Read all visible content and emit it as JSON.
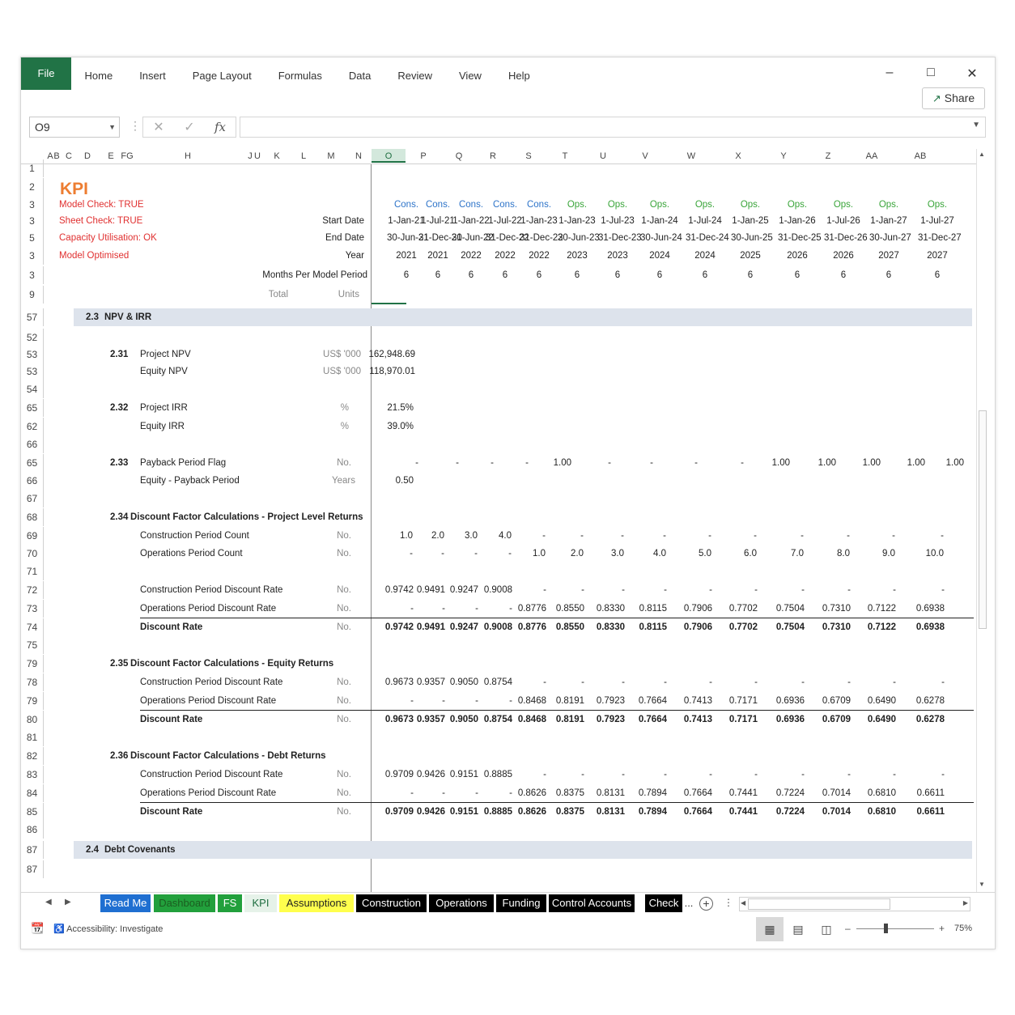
{
  "ribbon": {
    "file": "File",
    "menu": [
      "Home",
      "Insert",
      "Page Layout",
      "Formulas",
      "Data",
      "Review",
      "View",
      "Help"
    ],
    "share": "Share",
    "minimize": "–",
    "maximize": "□",
    "close": "✕"
  },
  "formula_bar": {
    "name_box": "O9",
    "fx": "fx",
    "cancel": "✕",
    "enter": "✓",
    "content": ""
  },
  "columns": [
    "A",
    "B",
    "C",
    "D",
    "E",
    "FG",
    "H",
    "J",
    "U",
    "K",
    "L",
    "M",
    "N",
    "O",
    "P",
    "Q",
    "R",
    "S",
    "T",
    "U",
    "V",
    "W",
    "X",
    "Y",
    "Z",
    "AA",
    "AB"
  ],
  "header": {
    "title": "KPI",
    "checks": [
      "Model Check: TRUE",
      "Sheet Check: TRUE",
      "Capacity Utilisation: OK",
      "Model Optimised"
    ],
    "row_labels": {
      "start": "Start Date",
      "end": "End Date",
      "year": "Year",
      "months": "Months Per Model Period",
      "total": "Total",
      "units": "Units"
    },
    "phases": [
      "Cons.",
      "Cons.",
      "Cons.",
      "Cons.",
      "Cons.",
      "Ops.",
      "Ops.",
      "Ops.",
      "Ops.",
      "Ops.",
      "Ops.",
      "Ops.",
      "Ops.",
      "Ops."
    ],
    "start_dates": [
      "1-Jan-21",
      "1-Jul-21",
      "1-Jan-22",
      "1-Jul-22",
      "1-Jan-23",
      "1-Jan-23",
      "1-Jul-23",
      "1-Jan-24",
      "1-Jul-24",
      "1-Jan-25",
      "1-Jan-26",
      "1-Jul-26",
      "1-Jan-27",
      "1-Jul-27"
    ],
    "end_dates": [
      "30-Jun-21",
      "31-Dec-21",
      "30-Jun-22",
      "31-Dec-22",
      "31-Dec-22",
      "30-Jun-23",
      "31-Dec-23",
      "30-Jun-24",
      "31-Dec-24",
      "30-Jun-25",
      "31-Dec-25",
      "31-Dec-26",
      "30-Jun-27",
      "31-Dec-27"
    ],
    "years": [
      "2021",
      "2021",
      "2022",
      "2022",
      "2022",
      "2023",
      "2023",
      "2024",
      "2024",
      "2025",
      "2026",
      "2026",
      "2027",
      "2027"
    ],
    "months": [
      "6",
      "6",
      "6",
      "6",
      "6",
      "6",
      "6",
      "6",
      "6",
      "6",
      "6",
      "6",
      "6",
      "6"
    ]
  },
  "row_numbers": [
    "1",
    "2",
    "3",
    "3",
    "5",
    "3",
    "3",
    "9",
    "57",
    "52",
    "53",
    "53",
    "54",
    "65",
    "62",
    "66",
    "65",
    "66",
    "67",
    "68",
    "69",
    "70",
    "71",
    "72",
    "73",
    "74",
    "75",
    "79",
    "78",
    "79",
    "80",
    "81",
    "82",
    "83",
    "84",
    "85",
    "86",
    "87",
    "87"
  ],
  "sections": {
    "s23": {
      "num": "2.3",
      "title": "NPV & IRR"
    },
    "s24": {
      "num": "2.4",
      "title": "Debt Covenants"
    },
    "s231": {
      "num": "2.31",
      "r1": "Project NPV",
      "r2": "Equity NPV",
      "unit": "US$ '000",
      "v1": "162,948.69",
      "v2": "118,970.01"
    },
    "s232": {
      "num": "2.32",
      "r1": "Project IRR",
      "r2": "Equity IRR",
      "unit": "%",
      "v1": "21.5%",
      "v2": "39.0%"
    },
    "s233": {
      "num": "2.33",
      "r1": "Payback Period Flag",
      "r2": "Equity - Payback Period",
      "u1": "No.",
      "u2": "Years",
      "flag": [
        "-",
        "-",
        "-",
        "-",
        "-",
        "1.00",
        "-",
        "-",
        "-",
        "-",
        "1.00",
        "1.00",
        "1.00",
        "1.00",
        "1.00"
      ],
      "v2": "0.50"
    },
    "s234": {
      "num": "2.34",
      "title": "Discount Factor Calculations - Project Level Returns"
    },
    "s235": {
      "num": "2.35",
      "title": "Discount Factor Calculations - Equity Returns"
    },
    "s236": {
      "num": "2.36",
      "title": "Discount Factor Calculations - Debt Returns"
    },
    "labels": {
      "cons_count": "Construction Period Count",
      "ops_count": "Operations Period Count",
      "cons_rate": "Construction Period Discount Rate",
      "ops_rate": "Operations Period Discount Rate",
      "disc": "Discount Rate",
      "no": "No."
    },
    "cons_count": [
      "1.0",
      "2.0",
      "3.0",
      "4.0",
      "-",
      "-",
      "-",
      "-",
      "-",
      "-",
      "-",
      "-",
      "-",
      "-"
    ],
    "ops_count": [
      "-",
      "-",
      "-",
      "-",
      "1.0",
      "2.0",
      "3.0",
      "4.0",
      "5.0",
      "6.0",
      "7.0",
      "8.0",
      "9.0",
      "10.0"
    ],
    "p_cons": [
      "0.9742",
      "0.9491",
      "0.9247",
      "0.9008",
      "-",
      "-",
      "-",
      "-",
      "-",
      "-",
      "-",
      "-",
      "-",
      "-"
    ],
    "p_ops": [
      "-",
      "-",
      "-",
      "-",
      "0.8776",
      "0.8550",
      "0.8330",
      "0.8115",
      "0.7906",
      "0.7702",
      "0.7504",
      "0.7310",
      "0.7122",
      "0.6938"
    ],
    "p_disc": [
      "0.9742",
      "0.9491",
      "0.9247",
      "0.9008",
      "0.8776",
      "0.8550",
      "0.8330",
      "0.8115",
      "0.7906",
      "0.7702",
      "0.7504",
      "0.7310",
      "0.7122",
      "0.6938"
    ],
    "e_cons": [
      "0.9673",
      "0.9357",
      "0.9050",
      "0.8754",
      "-",
      "-",
      "-",
      "-",
      "-",
      "-",
      "-",
      "-",
      "-",
      "-"
    ],
    "e_ops": [
      "-",
      "-",
      "-",
      "-",
      "0.8468",
      "0.8191",
      "0.7923",
      "0.7664",
      "0.7413",
      "0.7171",
      "0.6936",
      "0.6709",
      "0.6490",
      "0.6278"
    ],
    "e_disc": [
      "0.9673",
      "0.9357",
      "0.9050",
      "0.8754",
      "0.8468",
      "0.8191",
      "0.7923",
      "0.7664",
      "0.7413",
      "0.7171",
      "0.6936",
      "0.6709",
      "0.6490",
      "0.6278"
    ],
    "d_cons": [
      "0.9709",
      "0.9426",
      "0.9151",
      "0.8885",
      "-",
      "-",
      "-",
      "-",
      "-",
      "-",
      "-",
      "-",
      "-",
      "-"
    ],
    "d_ops": [
      "-",
      "-",
      "-",
      "-",
      "0.8626",
      "0.8375",
      "0.8131",
      "0.7894",
      "0.7664",
      "0.7441",
      "0.7224",
      "0.7014",
      "0.6810",
      "0.6611"
    ],
    "d_disc": [
      "0.9709",
      "0.9426",
      "0.9151",
      "0.8885",
      "0.8626",
      "0.8375",
      "0.8131",
      "0.7894",
      "0.7664",
      "0.7441",
      "0.7224",
      "0.7014",
      "0.6810",
      "0.6611"
    ]
  },
  "sheet_tabs": [
    {
      "label": "Read Me",
      "bg": "#1f6fd1",
      "fg": "#ffffff"
    },
    {
      "label": "Dashboard",
      "bg": "#22a03c",
      "fg": "#1b5e20"
    },
    {
      "label": "FS",
      "bg": "#22a03c",
      "fg": "#ffffff"
    },
    {
      "label": "KPI",
      "bg": "#e6f2e9",
      "fg": "#1e6e40"
    },
    {
      "label": "Assumptions",
      "bg": "#ffff4d",
      "fg": "#222222"
    },
    {
      "label": "Construction",
      "bg": "#000000",
      "fg": "#ffffff"
    },
    {
      "label": "Operations",
      "bg": "#000000",
      "fg": "#ffffff"
    },
    {
      "label": "Funding",
      "bg": "#000000",
      "fg": "#ffffff"
    },
    {
      "label": "Control Accounts",
      "bg": "#000000",
      "fg": "#ffffff"
    },
    {
      "label": "Check",
      "bg": "#000000",
      "fg": "#ffffff"
    }
  ],
  "tabs_more": "...",
  "status": {
    "accessibility": "Accessibility: Investigate",
    "zoom": "75%"
  }
}
